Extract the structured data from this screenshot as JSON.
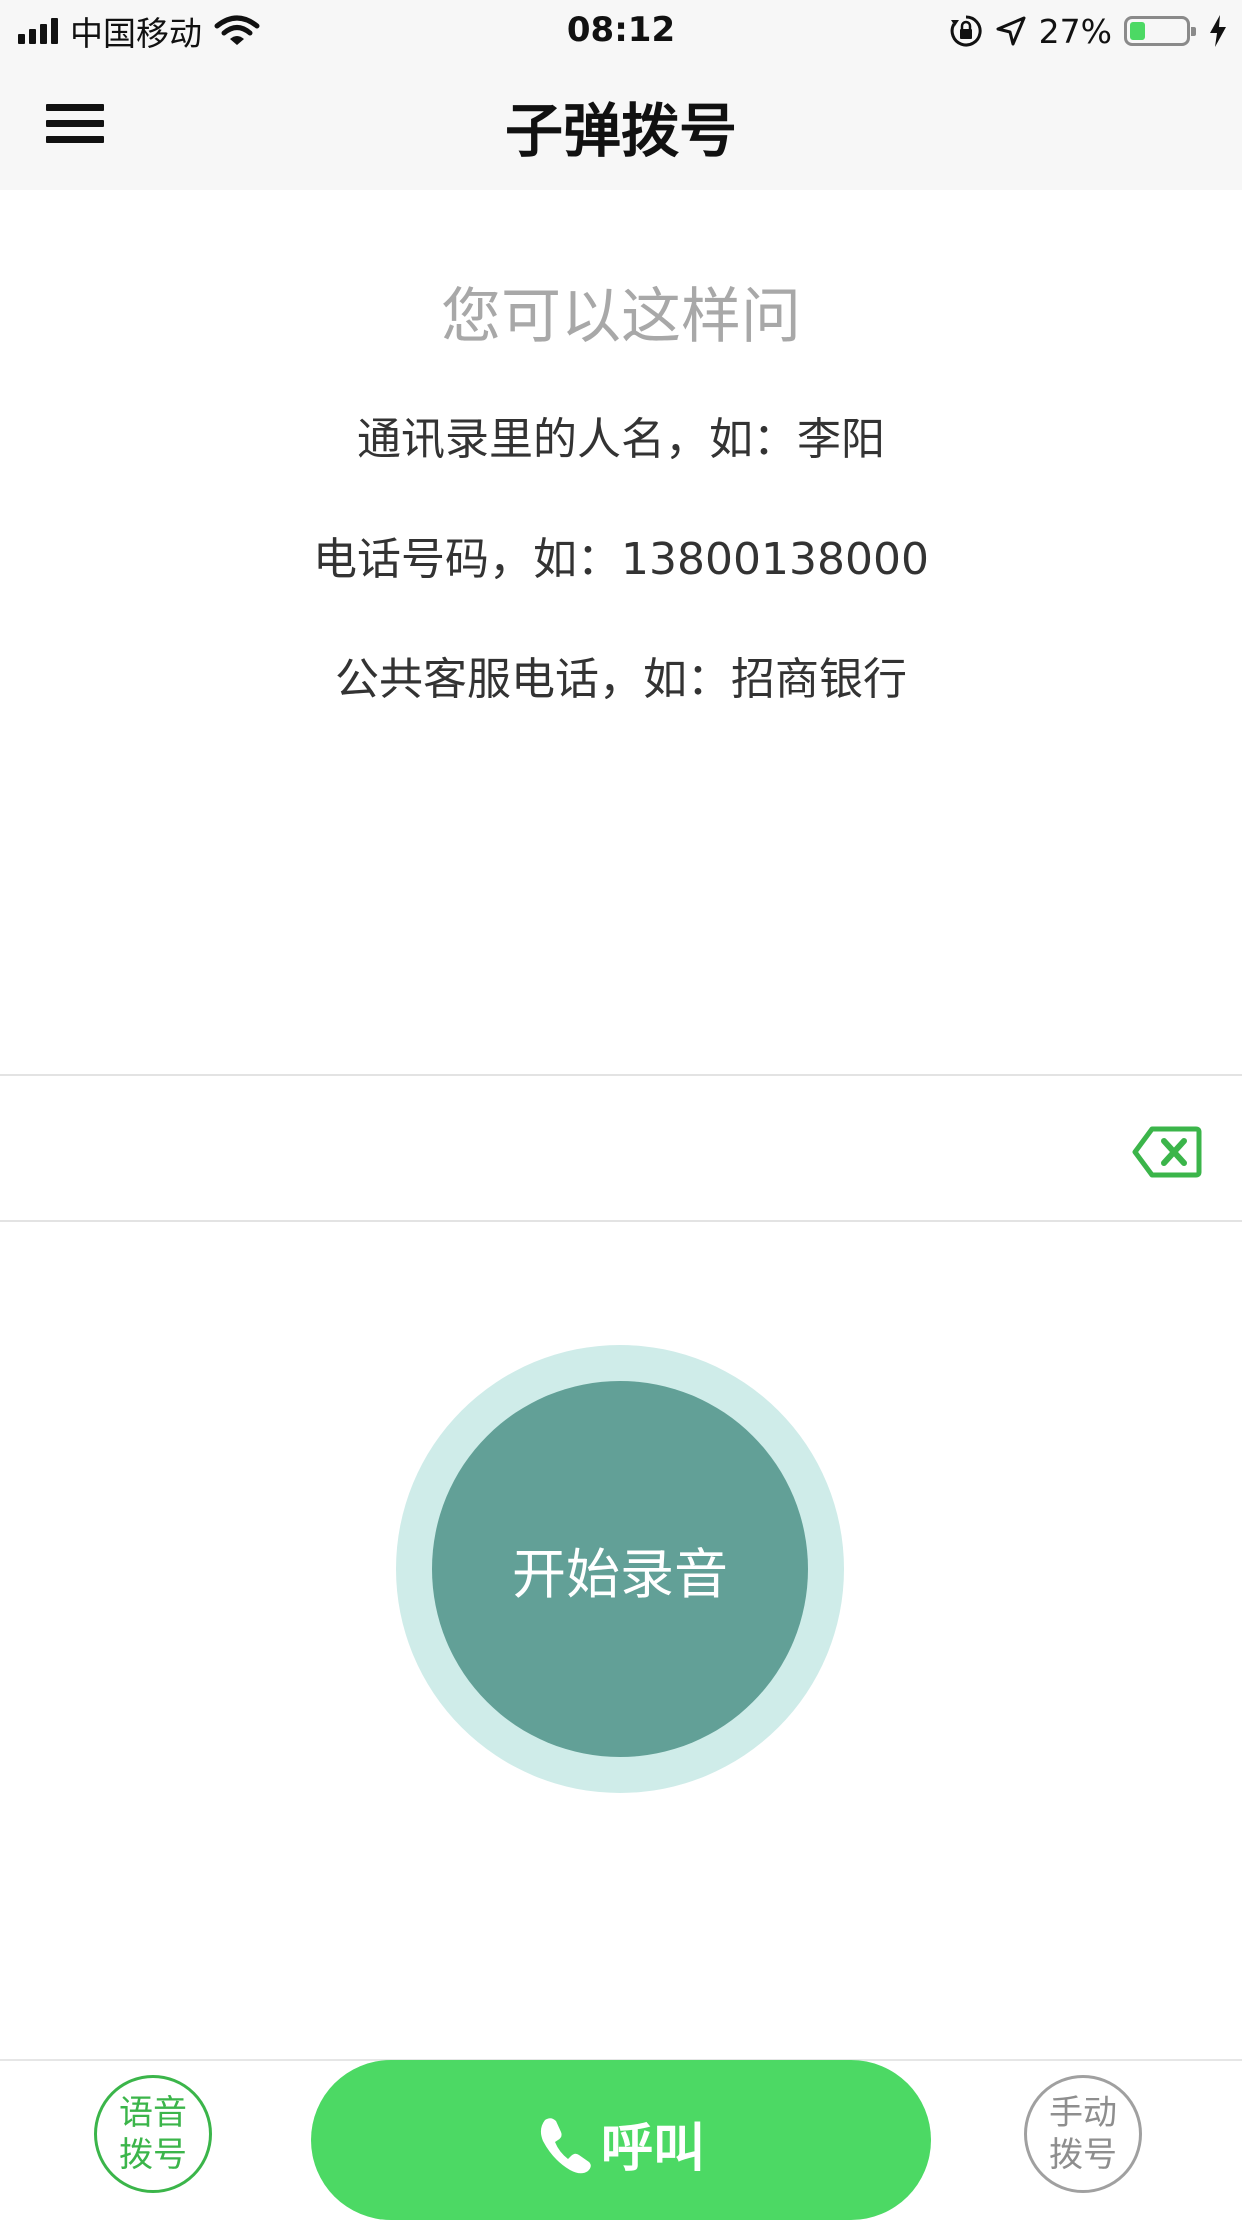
{
  "status_bar": {
    "carrier": "中国移动",
    "time": "08:12",
    "battery_percent": "27%",
    "battery_level": 0.27,
    "icons": [
      "signal-icon",
      "wifi-icon",
      "orientation-lock-icon",
      "location-icon",
      "battery-icon",
      "charging-icon"
    ]
  },
  "nav": {
    "title": "子弹拨号",
    "menu_icon": "hamburger-menu-icon"
  },
  "hints": {
    "title": "您可以这样问",
    "items": [
      "通讯录里的人名，如：李阳",
      "电话号码，如：13800138000",
      "公共客服电话，如：招商银行"
    ]
  },
  "input": {
    "value": "",
    "delete_icon": "backspace-delete-icon"
  },
  "record": {
    "label": "开始录音"
  },
  "bottom": {
    "voice_dial": [
      "语音",
      "拨号"
    ],
    "call_label": "呼叫",
    "call_icon": "phone-icon",
    "manual_dial": [
      "手动",
      "拨号"
    ]
  },
  "colors": {
    "accent_green": "#4cd964",
    "voice_green": "#3bb54a",
    "record_inner": "#62a097",
    "record_outer": "#cfece9",
    "hint_gray": "#a8a8a8"
  }
}
